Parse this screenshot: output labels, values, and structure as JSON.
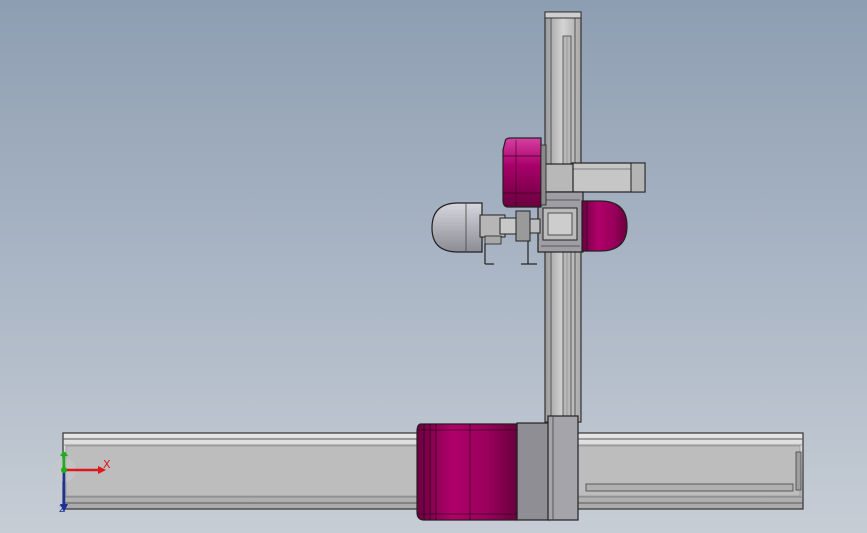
{
  "viewport": {
    "background_top": "#8e9eb2",
    "background_bottom": "#c6cdd5"
  },
  "colors": {
    "motor_magenta": "#a0005e",
    "rail_silver": "#c4c4c4",
    "edge_dark": "#333333",
    "carriage_gray": "#8e8e94"
  },
  "triad": {
    "x_axis_label": "X",
    "z_axis_label": "Z",
    "x_color": "#e0161a",
    "y_color": "#1ab01a",
    "z_color": "#20309a"
  }
}
